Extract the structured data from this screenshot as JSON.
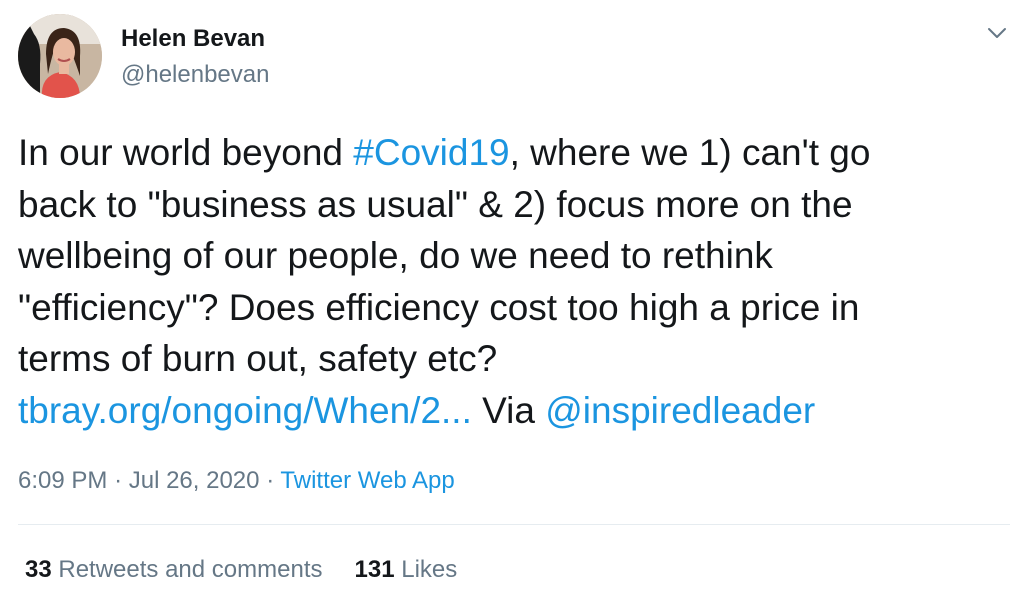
{
  "author": {
    "name": "Helen Bevan",
    "handle": "@helenbevan"
  },
  "tweet": {
    "line1_pre": "In our world beyond ",
    "hashtag": "#Covid19",
    "line1_post": ", where we 1) can't go",
    "line2": "back to \"business as usual\" & 2) focus more on the",
    "line3": "wellbeing of our people, do we need to rethink",
    "line4": "\"efficiency\"? Does efficiency cost too high a price in",
    "line5": "terms of burn out, safety etc?",
    "url": "tbray.org/ongoing/When/2...",
    "via_label": "Via",
    "mention": "@inspiredleader"
  },
  "meta": {
    "time": "6:09 PM",
    "separator": "·",
    "date": "Jul 26, 2020",
    "app": "Twitter Web App"
  },
  "stats": {
    "retweets_count": "33",
    "retweets_label": "Retweets and comments",
    "likes_count": "131",
    "likes_label": "Likes"
  },
  "icons": {
    "caret": "chevron-down-icon"
  },
  "colors": {
    "link": "#1b95e0",
    "secondary_text": "#657786",
    "primary_text": "#14171a",
    "divider": "#e6ecf0"
  }
}
